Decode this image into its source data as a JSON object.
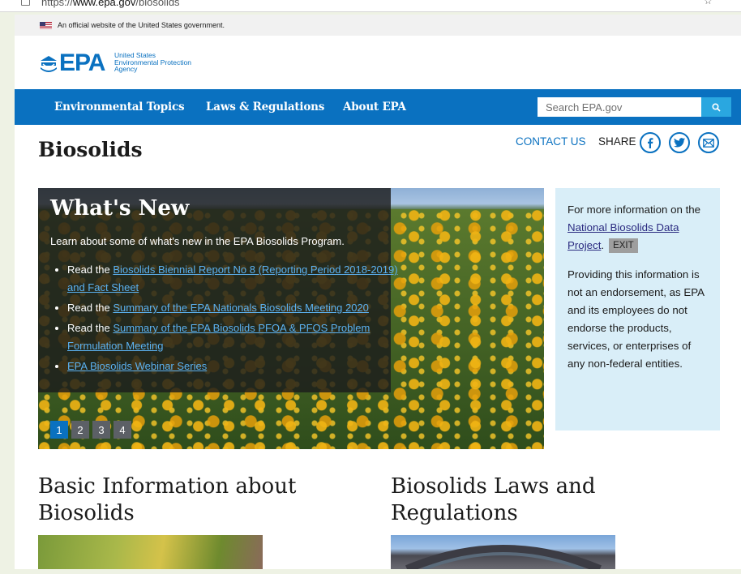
{
  "browser": {
    "url_prefix": "https://",
    "url_domain": "www.epa.gov",
    "url_path": "/biosolids"
  },
  "gov_banner": {
    "text": "An official website of the United States government."
  },
  "logo": {
    "text": "EPA",
    "sub1": "United States",
    "sub2": "Environmental Protection",
    "sub3": "Agency"
  },
  "nav": {
    "items": [
      "Environmental Topics",
      "Laws & Regulations",
      "About EPA"
    ]
  },
  "search": {
    "placeholder": "Search EPA.gov"
  },
  "page": {
    "title": "Biosolids",
    "contact": "CONTACT US",
    "share": "SHARE"
  },
  "hero": {
    "title": "What's New",
    "lead": "Learn about some of what's new in the EPA Biosolids Program.",
    "items": [
      {
        "prefix": "Read the ",
        "link": "Biosolids Biennial Report No 8 (Reporting Period 2018-2019) and Fact Sheet"
      },
      {
        "prefix": "Read the ",
        "link": "Summary of the EPA Nationals Biosolids Meeting 2020"
      },
      {
        "prefix": "Read the ",
        "link": "Summary of the EPA Biosolids PFOA & PFOS Problem Formulation Meeting"
      },
      {
        "prefix": "",
        "link": "EPA Biosolids Webinar Series"
      }
    ],
    "pages": [
      "1",
      "2",
      "3",
      "4"
    ]
  },
  "info_box": {
    "intro": "For more information on the",
    "link": "National Biosolids Data Project",
    "period": ".",
    "exit": "EXIT",
    "disclaimer": "Providing this information is not an endorsement, as EPA and its employees do not endorse the products, services, or enterprises of any non-federal entities."
  },
  "sections": {
    "left_title": "Basic Information about Biosolids",
    "right_title": "Biosolids Laws and Regulations"
  },
  "colors": {
    "epa_blue": "#0a71c0",
    "search_button": "#2aa7e0",
    "info_bg": "#d9eef8"
  }
}
